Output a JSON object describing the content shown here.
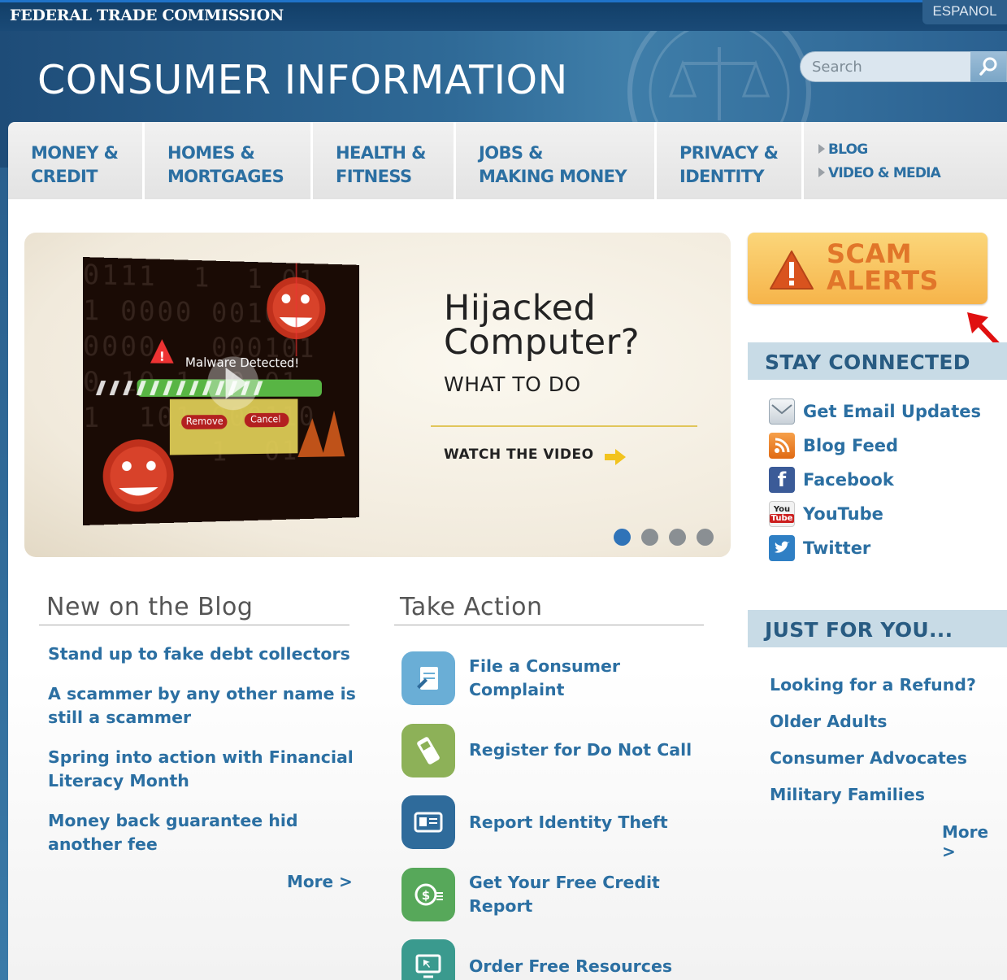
{
  "agency": {
    "name": "FEDERAL TRADE COMMISSION",
    "language_link": "ESPANOL"
  },
  "header": {
    "title": "CONSUMER INFORMATION"
  },
  "search": {
    "placeholder": "Search"
  },
  "nav": {
    "items": [
      {
        "line1": "MONEY &",
        "line2": "CREDIT"
      },
      {
        "line1": "HOMES &",
        "line2": "MORTGAGES"
      },
      {
        "line1": "HEALTH &",
        "line2": "FITNESS"
      },
      {
        "line1": "JOBS &",
        "line2": "MAKING MONEY"
      },
      {
        "line1": "PRIVACY &",
        "line2": "IDENTITY"
      }
    ],
    "secondary": [
      "BLOG",
      "VIDEO & MEDIA"
    ]
  },
  "hero": {
    "title": "Hijacked Computer?",
    "subtitle": "WHAT TO DO",
    "cta": "WATCH THE VIDEO",
    "video_overlay": {
      "alert_text": "Malware Detected!",
      "remove_label": "Remove",
      "cancel_label": "Cancel"
    },
    "slide_count": 4,
    "active_slide": 1
  },
  "scam_alerts": {
    "label": "SCAM ALERTS"
  },
  "stay_connected": {
    "title": "STAY CONNECTED",
    "items": [
      {
        "label": "Get Email Updates",
        "icon": "email-icon"
      },
      {
        "label": "Blog Feed",
        "icon": "rss-icon"
      },
      {
        "label": "Facebook",
        "icon": "facebook-icon"
      },
      {
        "label": "YouTube",
        "icon": "youtube-icon"
      },
      {
        "label": "Twitter",
        "icon": "twitter-icon"
      }
    ]
  },
  "just_for_you": {
    "title": "JUST FOR YOU...",
    "items": [
      "Looking for a Refund?",
      "Older Adults",
      "Consumer Advocates",
      "Military Families"
    ],
    "more": "More >"
  },
  "blog": {
    "title": "New on the Blog",
    "items": [
      "Stand up to fake debt collectors",
      "A scammer by any other name is still a scammer",
      "Spring into action with Financial Literacy Month",
      "Money back guarantee hid another fee"
    ],
    "more": "More >"
  },
  "take_action": {
    "title": "Take Action",
    "items": [
      {
        "label": "File a Consumer Complaint",
        "icon": "complaint-icon",
        "color": "#6aaed6"
      },
      {
        "label": "Register for Do Not Call",
        "icon": "phone-icon",
        "color": "#8db158"
      },
      {
        "label": "Report Identity Theft",
        "icon": "id-card-icon",
        "color": "#2f6b9b"
      },
      {
        "label": "Get Your Free Credit Report",
        "icon": "coin-icon",
        "color": "#57a85a"
      },
      {
        "label": "Order Free Resources",
        "icon": "monitor-icon",
        "color": "#3a9a8e"
      }
    ]
  },
  "colors": {
    "link": "#2b6fa2",
    "header_bg": "#2f6a97",
    "scam_orange": "#e1762a"
  }
}
